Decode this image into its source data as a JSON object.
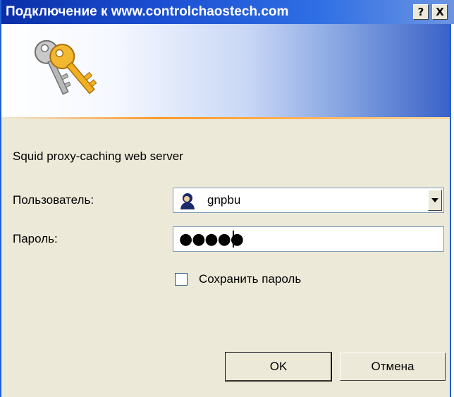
{
  "window": {
    "title": "Подключение к www.controlchaostech.com",
    "help_button": "?",
    "close_button": "X"
  },
  "dialog": {
    "realm_text": "Squid proxy-caching web server",
    "user_label": "Пользователь:",
    "user_value": "gnpbu",
    "password_label": "Пароль:",
    "password_mask": "●●●●●",
    "remember_label": "Сохранить пароль",
    "remember_checked": false
  },
  "buttons": {
    "ok": "OK",
    "cancel": "Отмена"
  },
  "icons": [
    "keys-icon",
    "user-icon",
    "dropdown-arrow-icon"
  ],
  "colors": {
    "titlebar": "#1b4fd2",
    "dialog_bg": "#ece9d8",
    "accent_line": "#ff9a2e"
  }
}
